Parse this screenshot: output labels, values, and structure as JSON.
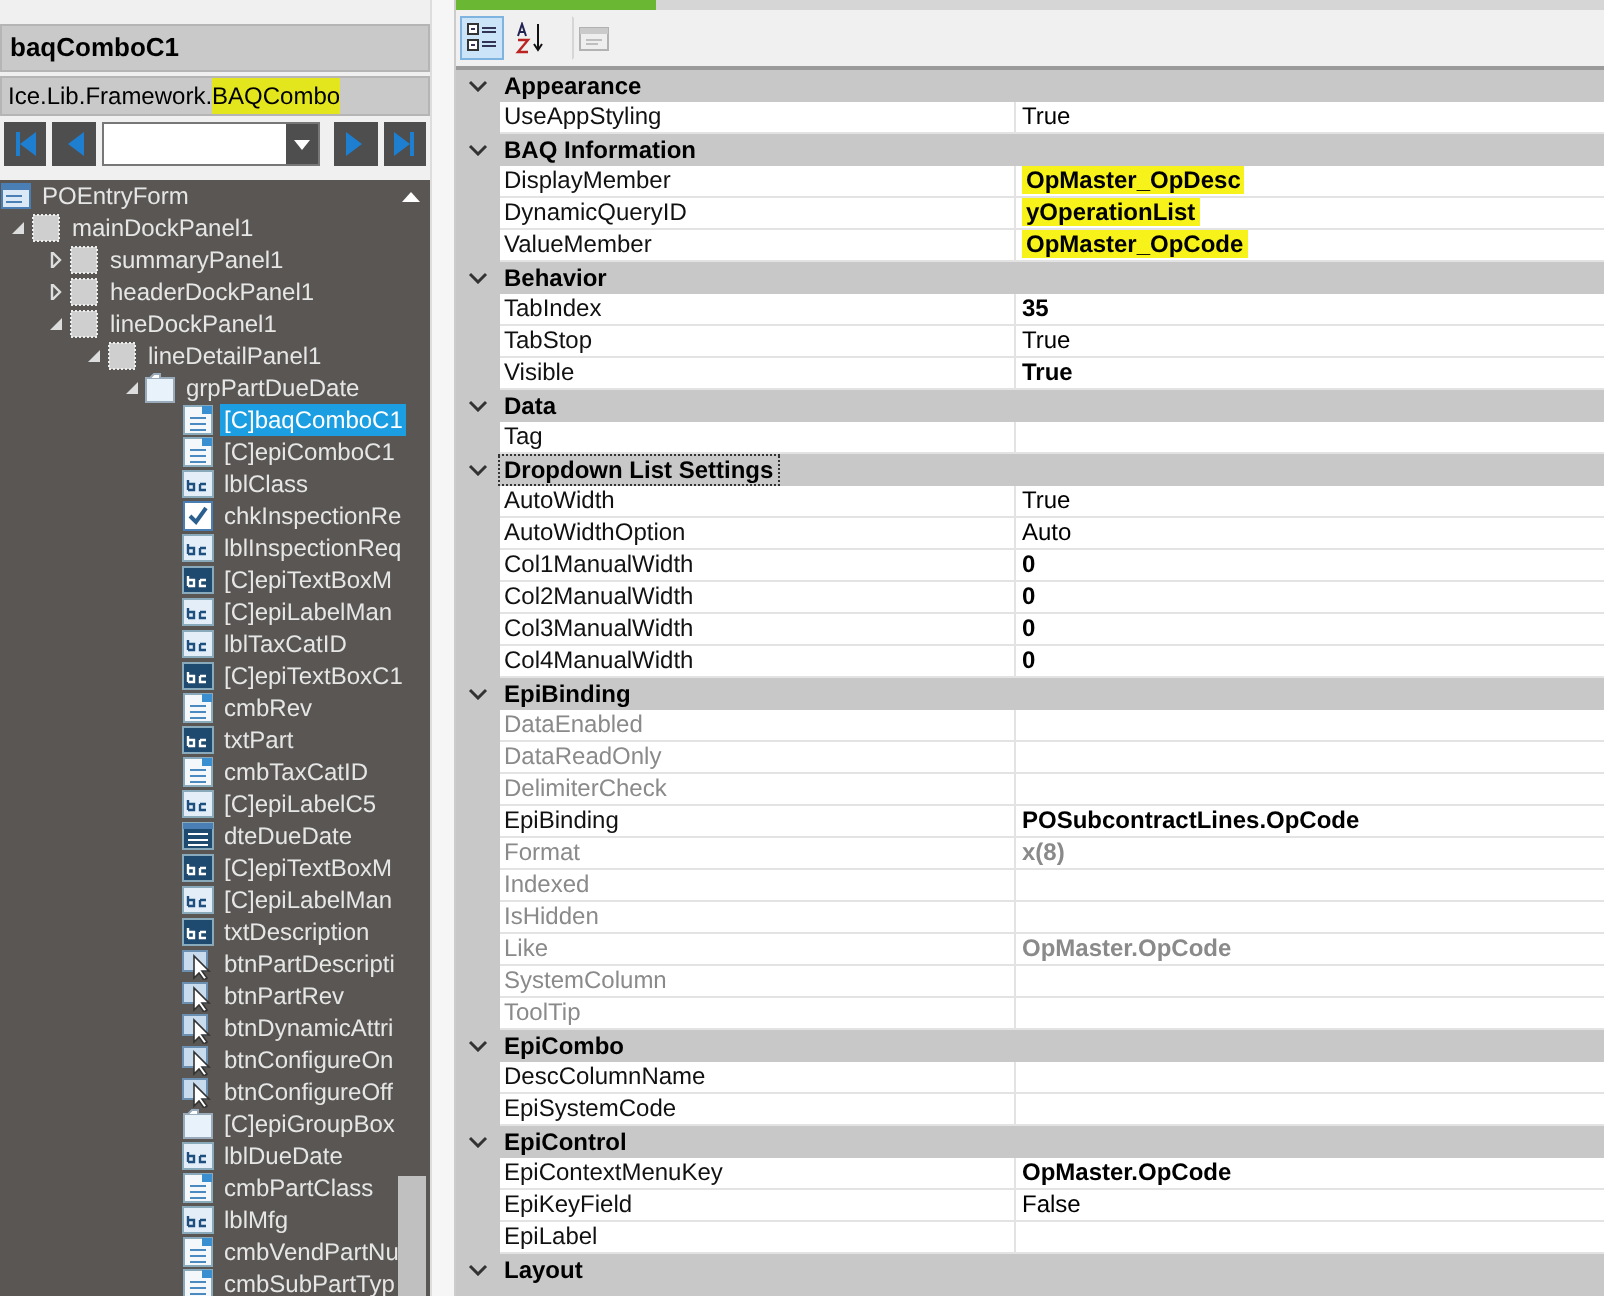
{
  "control_title": "baqComboC1",
  "type_name": [
    {
      "text": "Ice.Lib.Framework.",
      "highlighted": false
    },
    {
      "text": "BAQCombo",
      "highlighted": true
    }
  ],
  "navigator": {
    "buttons": [
      {
        "kind": "first"
      },
      {
        "kind": "prev"
      }
    ],
    "after_buttons": [
      {
        "kind": "next"
      },
      {
        "kind": "last"
      }
    ]
  },
  "tree": {
    "root": {
      "label": "POEntryForm",
      "kind": "form",
      "selected": false,
      "children": [
        {
          "label": "mainDockPanel1",
          "kind": "panel",
          "selected": false,
          "expanded": true,
          "children": [
            {
              "label": "summaryPanel1",
              "kind": "panel",
              "selected": false,
              "expanded": false
            },
            {
              "label": "headerDockPanel1",
              "kind": "panel",
              "selected": false,
              "expanded": false
            },
            {
              "label": "lineDockPanel1",
              "kind": "panel",
              "selected": false,
              "expanded": true,
              "children": [
                {
                  "label": "lineDetailPanel1",
                  "kind": "panel",
                  "selected": false,
                  "expanded": true,
                  "children": [
                    {
                      "label": "grpPartDueDate",
                      "kind": "group",
                      "selected": false,
                      "expanded": true,
                      "children": [
                        {
                          "label": "[C]baqComboC1",
                          "kind": "combo",
                          "selected": true
                        },
                        {
                          "label": "[C]epiComboC1",
                          "kind": "combo",
                          "selected": false
                        },
                        {
                          "label": "lblClass",
                          "kind": "label",
                          "selected": false
                        },
                        {
                          "label": "chkInspectionRe",
                          "kind": "check",
                          "selected": false
                        },
                        {
                          "label": "lblInspectionReq",
                          "kind": "label",
                          "selected": false
                        },
                        {
                          "label": "[C]epiTextBoxM",
                          "kind": "textbox",
                          "selected": false
                        },
                        {
                          "label": "[C]epiLabelMan",
                          "kind": "label",
                          "selected": false
                        },
                        {
                          "label": "lblTaxCatID",
                          "kind": "label",
                          "selected": false
                        },
                        {
                          "label": "[C]epiTextBoxC1",
                          "kind": "textbox",
                          "selected": false
                        },
                        {
                          "label": "cmbRev",
                          "kind": "combo",
                          "selected": false
                        },
                        {
                          "label": "txtPart",
                          "kind": "textbox",
                          "selected": false
                        },
                        {
                          "label": "cmbTaxCatID",
                          "kind": "combo",
                          "selected": false
                        },
                        {
                          "label": "[C]epiLabelC5",
                          "kind": "label",
                          "selected": false
                        },
                        {
                          "label": "dteDueDate",
                          "kind": "date",
                          "selected": false
                        },
                        {
                          "label": "[C]epiTextBoxM",
                          "kind": "textbox",
                          "selected": false
                        },
                        {
                          "label": "[C]epiLabelMan",
                          "kind": "label",
                          "selected": false
                        },
                        {
                          "label": "txtDescription",
                          "kind": "textbox",
                          "selected": false
                        },
                        {
                          "label": "btnPartDescripti",
                          "kind": "button",
                          "selected": false
                        },
                        {
                          "label": "btnPartRev",
                          "kind": "button",
                          "selected": false
                        },
                        {
                          "label": "btnDynamicAttri",
                          "kind": "button",
                          "selected": false
                        },
                        {
                          "label": "btnConfigureOn",
                          "kind": "button",
                          "selected": false
                        },
                        {
                          "label": "btnConfigureOff",
                          "kind": "button",
                          "selected": false
                        },
                        {
                          "label": "[C]epiGroupBox",
                          "kind": "group",
                          "selected": false
                        },
                        {
                          "label": "lblDueDate",
                          "kind": "label",
                          "selected": false
                        },
                        {
                          "label": "cmbPartClass",
                          "kind": "combo",
                          "selected": false
                        },
                        {
                          "label": "lblMfg",
                          "kind": "label",
                          "selected": false
                        },
                        {
                          "label": "cmbVendPartNu",
                          "kind": "combo",
                          "selected": false
                        },
                        {
                          "label": "cmbSubPartTyp",
                          "kind": "combo",
                          "selected": false
                        }
                      ]
                    }
                  ]
                }
              ]
            }
          ]
        }
      ]
    }
  },
  "toolbar": [
    {
      "kind": "categorized",
      "selected": true,
      "disabled": false
    },
    {
      "kind": "alphabetical",
      "selected": false,
      "disabled": false
    },
    {
      "kind": "property-pages",
      "selected": false,
      "disabled": true
    }
  ],
  "categories": [
    {
      "name": "Appearance",
      "expanded": true,
      "focused": false,
      "properties": [
        {
          "name": "UseAppStyling",
          "value": "True",
          "modified": false,
          "disabled": false,
          "highlighted": false
        }
      ]
    },
    {
      "name": "BAQ Information",
      "expanded": true,
      "focused": false,
      "properties": [
        {
          "name": "DisplayMember",
          "value": "OpMaster_OpDesc",
          "modified": true,
          "disabled": false,
          "highlighted": true
        },
        {
          "name": "DynamicQueryID",
          "value": "yOperationList",
          "modified": true,
          "disabled": false,
          "highlighted": true
        },
        {
          "name": "ValueMember",
          "value": "OpMaster_OpCode",
          "modified": true,
          "disabled": false,
          "highlighted": true
        }
      ]
    },
    {
      "name": "Behavior",
      "expanded": true,
      "focused": false,
      "properties": [
        {
          "name": "TabIndex",
          "value": "35",
          "modified": true,
          "disabled": false,
          "highlighted": false
        },
        {
          "name": "TabStop",
          "value": "True",
          "modified": false,
          "disabled": false,
          "highlighted": false
        },
        {
          "name": "Visible",
          "value": "True",
          "modified": true,
          "disabled": false,
          "highlighted": false
        }
      ]
    },
    {
      "name": "Data",
      "expanded": true,
      "focused": false,
      "properties": [
        {
          "name": "Tag",
          "disabled": false
        }
      ]
    },
    {
      "name": "Dropdown List Settings",
      "expanded": true,
      "focused": true,
      "properties": [
        {
          "name": "AutoWidth",
          "value": "True",
          "modified": false,
          "disabled": false,
          "highlighted": false
        },
        {
          "name": "AutoWidthOption",
          "value": "Auto",
          "modified": false,
          "disabled": false,
          "highlighted": false
        },
        {
          "name": "Col1ManualWidth",
          "value": "0",
          "modified": true,
          "disabled": false,
          "highlighted": false
        },
        {
          "name": "Col2ManualWidth",
          "value": "0",
          "modified": true,
          "disabled": false,
          "highlighted": false
        },
        {
          "name": "Col3ManualWidth",
          "value": "0",
          "modified": true,
          "disabled": false,
          "highlighted": false
        },
        {
          "name": "Col4ManualWidth",
          "value": "0",
          "modified": true,
          "disabled": false,
          "highlighted": false
        }
      ]
    },
    {
      "name": "EpiBinding",
      "expanded": true,
      "focused": false,
      "properties": [
        {
          "name": "DataEnabled",
          "disabled": true
        },
        {
          "name": "DataReadOnly",
          "disabled": true
        },
        {
          "name": "DelimiterCheck",
          "disabled": true
        },
        {
          "name": "EpiBinding",
          "value": "POSubcontractLines.OpCode",
          "modified": true,
          "disabled": false,
          "highlighted": false
        },
        {
          "name": "Format",
          "value": "x(8)",
          "modified": true,
          "disabled": true,
          "highlighted": false
        },
        {
          "name": "Indexed",
          "disabled": true
        },
        {
          "name": "IsHidden",
          "disabled": true
        },
        {
          "name": "Like",
          "value": "OpMaster.OpCode",
          "modified": true,
          "disabled": true,
          "highlighted": false
        },
        {
          "name": "SystemColumn",
          "disabled": true
        },
        {
          "name": "ToolTip",
          "disabled": true
        }
      ]
    },
    {
      "name": "EpiCombo",
      "expanded": true,
      "focused": false,
      "properties": [
        {
          "name": "DescColumnName",
          "disabled": false
        },
        {
          "name": "EpiSystemCode",
          "disabled": false
        }
      ]
    },
    {
      "name": "EpiControl",
      "expanded": true,
      "focused": false,
      "properties": [
        {
          "name": "EpiContextMenuKey",
          "value": "OpMaster.OpCode",
          "modified": true,
          "disabled": false,
          "highlighted": false
        },
        {
          "name": "EpiKeyField",
          "value": "False",
          "modified": false,
          "disabled": false,
          "highlighted": false
        },
        {
          "name": "EpiLabel",
          "disabled": false
        }
      ]
    },
    {
      "name": "Layout",
      "expanded": true,
      "focused": false
    }
  ]
}
